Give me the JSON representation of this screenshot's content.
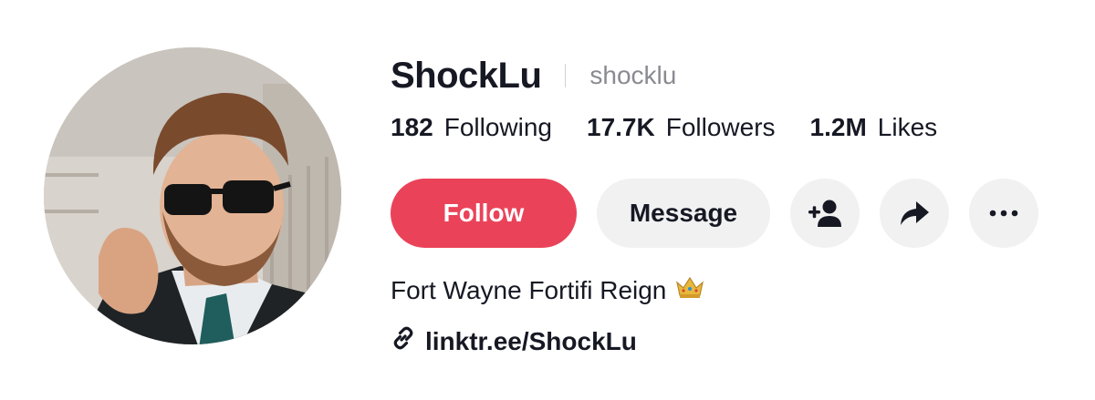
{
  "profile": {
    "display_name": "ShockLu",
    "handle": "shocklu",
    "bio": "Fort Wayne Fortifi Reign",
    "bio_emoji": "crown-icon",
    "link": "linktr.ee/ShockLu"
  },
  "stats": [
    {
      "number": "182",
      "label": "Following"
    },
    {
      "number": "17.7K",
      "label": "Followers"
    },
    {
      "number": "1.2M",
      "label": "Likes"
    }
  ],
  "buttons": {
    "follow_label": "Follow",
    "message_label": "Message"
  },
  "icons": {
    "add_friend": "add-friend-icon",
    "share": "share-icon",
    "more": "more-icon",
    "link": "link-icon"
  },
  "colors": {
    "follow_bg": "#ea4359",
    "secondary_bg": "#f1f1f2",
    "text": "#161823",
    "muted": "#8a8b91"
  }
}
